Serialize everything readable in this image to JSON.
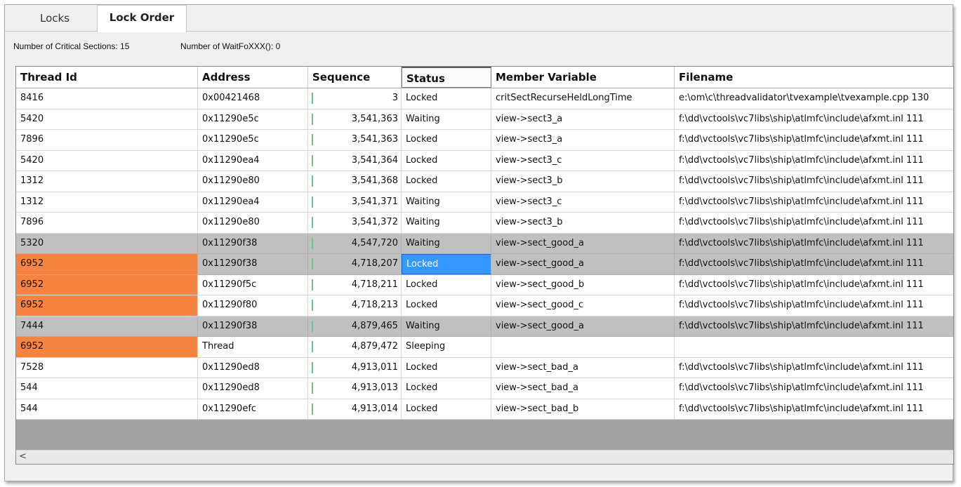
{
  "tabs": [
    {
      "label": "Locks"
    },
    {
      "label": "Lock Order"
    }
  ],
  "info": {
    "critical_sections": "Number of Critical Sections:  15",
    "waitfor": "Number of WaitFoXXX():  0"
  },
  "columns": [
    "Thread Id",
    "Address",
    "Sequence",
    "Status",
    "Member Variable",
    "Filename"
  ],
  "rows": [
    {
      "tid": "8416",
      "addr": "0x00421468",
      "seq": "3",
      "status": "Locked",
      "member": "critSectRecurseHeldLongTime",
      "file": "e:\\om\\c\\threadvalidator\\tvexample\\tvexample.cpp 130"
    },
    {
      "tid": "5420",
      "addr": "0x11290e5c",
      "seq": "3,541,363",
      "status": "Waiting",
      "member": "view->sect3_a",
      "file": "f:\\dd\\vctools\\vc7libs\\ship\\atlmfc\\include\\afxmt.inl 111"
    },
    {
      "tid": "7896",
      "addr": "0x11290e5c",
      "seq": "3,541,363",
      "status": "Locked",
      "member": "view->sect3_a",
      "file": "f:\\dd\\vctools\\vc7libs\\ship\\atlmfc\\include\\afxmt.inl 111"
    },
    {
      "tid": "5420",
      "addr": "0x11290ea4",
      "seq": "3,541,364",
      "status": "Locked",
      "member": "view->sect3_c",
      "file": "f:\\dd\\vctools\\vc7libs\\ship\\atlmfc\\include\\afxmt.inl 111"
    },
    {
      "tid": "1312",
      "addr": "0x11290e80",
      "seq": "3,541,368",
      "status": "Locked",
      "member": "view->sect3_b",
      "file": "f:\\dd\\vctools\\vc7libs\\ship\\atlmfc\\include\\afxmt.inl 111"
    },
    {
      "tid": "1312",
      "addr": "0x11290ea4",
      "seq": "3,541,371",
      "status": "Waiting",
      "member": "view->sect3_c",
      "file": "f:\\dd\\vctools\\vc7libs\\ship\\atlmfc\\include\\afxmt.inl 111"
    },
    {
      "tid": "7896",
      "addr": "0x11290e80",
      "seq": "3,541,372",
      "status": "Waiting",
      "member": "view->sect3_b",
      "file": "f:\\dd\\vctools\\vc7libs\\ship\\atlmfc\\include\\afxmt.inl 111"
    },
    {
      "tid": "5320",
      "addr": "0x11290f38",
      "seq": "4,547,720",
      "status": "Waiting",
      "member": "view->sect_good_a",
      "file": "f:\\dd\\vctools\\vc7libs\\ship\\atlmfc\\include\\afxmt.inl 111"
    },
    {
      "tid": "6952",
      "addr": "0x11290f38",
      "seq": "4,718,207",
      "status": "Locked",
      "member": "view->sect_good_a",
      "file": "f:\\dd\\vctools\\vc7libs\\ship\\atlmfc\\include\\afxmt.inl 111"
    },
    {
      "tid": "6952",
      "addr": "0x11290f5c",
      "seq": "4,718,211",
      "status": "Locked",
      "member": "view->sect_good_b",
      "file": "f:\\dd\\vctools\\vc7libs\\ship\\atlmfc\\include\\afxmt.inl 111"
    },
    {
      "tid": "6952",
      "addr": "0x11290f80",
      "seq": "4,718,213",
      "status": "Locked",
      "member": "view->sect_good_c",
      "file": "f:\\dd\\vctools\\vc7libs\\ship\\atlmfc\\include\\afxmt.inl 111"
    },
    {
      "tid": "7444",
      "addr": "0x11290f38",
      "seq": "4,879,465",
      "status": "Waiting",
      "member": "view->sect_good_a",
      "file": "f:\\dd\\vctools\\vc7libs\\ship\\atlmfc\\include\\afxmt.inl 111"
    },
    {
      "tid": "6952",
      "addr": "Thread",
      "seq": "4,879,472",
      "status": "Sleeping",
      "member": "",
      "file": ""
    },
    {
      "tid": "7528",
      "addr": "0x11290ed8",
      "seq": "4,913,011",
      "status": "Locked",
      "member": "view->sect_bad_a",
      "file": "f:\\dd\\vctools\\vc7libs\\ship\\atlmfc\\include\\afxmt.inl 111"
    },
    {
      "tid": "544",
      "addr": "0x11290ed8",
      "seq": "4,913,013",
      "status": "Locked",
      "member": "view->sect_bad_a",
      "file": "f:\\dd\\vctools\\vc7libs\\ship\\atlmfc\\include\\afxmt.inl 111"
    },
    {
      "tid": "544",
      "addr": "0x11290efc",
      "seq": "4,913,014",
      "status": "Locked",
      "member": "view->sect_bad_b",
      "file": "f:\\dd\\vctools\\vc7libs\\ship\\atlmfc\\include\\afxmt.inl 111"
    }
  ],
  "scrollbar": {
    "left_arrow": "<"
  },
  "colors": {
    "thread_highlight": "#f78340",
    "selected": "#3399ff",
    "group_row": "#c0c0c0",
    "sequence_bar": "#6ec48a"
  },
  "icons": {
    "scroll_left": "chevron-left-icon"
  }
}
